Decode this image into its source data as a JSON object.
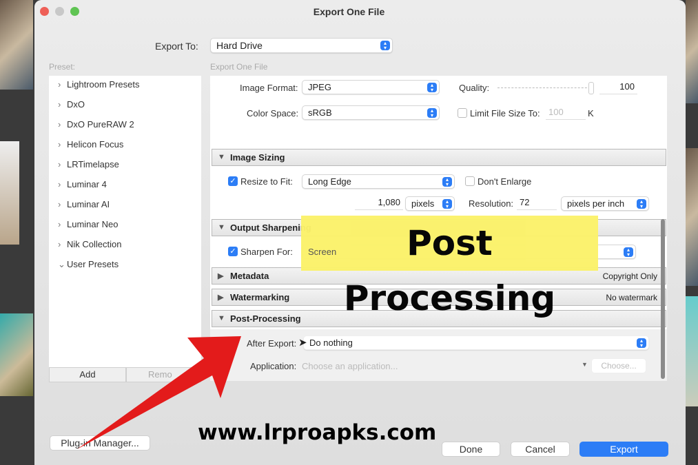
{
  "window": {
    "title": "Export One File"
  },
  "export_to": {
    "label": "Export To:",
    "value": "Hard Drive"
  },
  "preset": {
    "label": "Preset:",
    "items": [
      {
        "label": "Lightroom Presets",
        "expanded": false
      },
      {
        "label": "DxO",
        "expanded": false
      },
      {
        "label": "DxO PureRAW 2",
        "expanded": false
      },
      {
        "label": "Helicon Focus",
        "expanded": false
      },
      {
        "label": "LRTimelapse",
        "expanded": false
      },
      {
        "label": "Luminar 4",
        "expanded": false
      },
      {
        "label": "Luminar AI",
        "expanded": false
      },
      {
        "label": "Luminar Neo",
        "expanded": false
      },
      {
        "label": "Nik Collection",
        "expanded": false
      },
      {
        "label": "User Presets",
        "expanded": true
      }
    ],
    "add": "Add",
    "remove": "Remo"
  },
  "panel_header": "Export One File",
  "file_settings": {
    "image_format_label": "Image Format:",
    "image_format": "JPEG",
    "quality_label": "Quality:",
    "quality": "100",
    "quality_percent": 100,
    "color_space_label": "Color Space:",
    "color_space": "sRGB",
    "limit_label": "Limit File Size To:",
    "limit_value": "100",
    "limit_unit": "K",
    "limit_checked": false
  },
  "image_sizing": {
    "title": "Image Sizing",
    "resize_label": "Resize to Fit:",
    "resize_checked": true,
    "resize_mode": "Long Edge",
    "dont_enlarge": "Don't Enlarge",
    "size": "1,080",
    "size_unit": "pixels",
    "resolution_label": "Resolution:",
    "resolution": "72",
    "resolution_unit": "pixels per inch"
  },
  "output_sharpening": {
    "title": "Output Sharpening",
    "sharpen_label": "Sharpen For:",
    "sharpen_checked": true,
    "sharpen_for": "Screen"
  },
  "metadata": {
    "title": "Metadata",
    "value": "Copyright Only"
  },
  "watermarking": {
    "title": "Watermarking",
    "value": "No watermark"
  },
  "post_processing": {
    "title": "Post-Processing",
    "after_label": "After Export:",
    "after_value": "Do nothing",
    "app_label": "Application:",
    "app_placeholder": "Choose an application...",
    "choose": "Choose..."
  },
  "footer": {
    "plugin_manager": "Plug-in Manager...",
    "done": "Done",
    "cancel": "Cancel",
    "export": "Export"
  },
  "overlay": {
    "banner": "Post Processing",
    "watermark": "www.lrproapks.com",
    "banner_color": "#fbf26a",
    "arrow_color": "#e31b1b"
  },
  "colors": {
    "accent": "#2c7df6"
  }
}
